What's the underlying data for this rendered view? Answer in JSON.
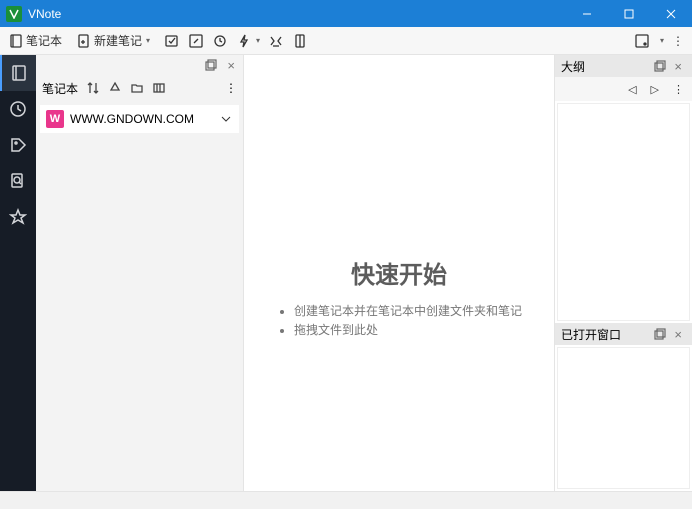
{
  "window": {
    "title": "VNote"
  },
  "toolbar": {
    "notebook": "笔记本",
    "new_note": "新建笔记"
  },
  "sidebar": {
    "notebook_label": "笔记本",
    "item": {
      "badge": "W",
      "name": "WWW.GNDOWN.COM"
    }
  },
  "center": {
    "heading": "快速开始",
    "bullets": [
      "创建笔记本并在笔记本中创建文件夹和笔记",
      "拖拽文件到此处"
    ]
  },
  "right": {
    "outline_title": "大纲",
    "opened_title": "已打开窗口"
  }
}
